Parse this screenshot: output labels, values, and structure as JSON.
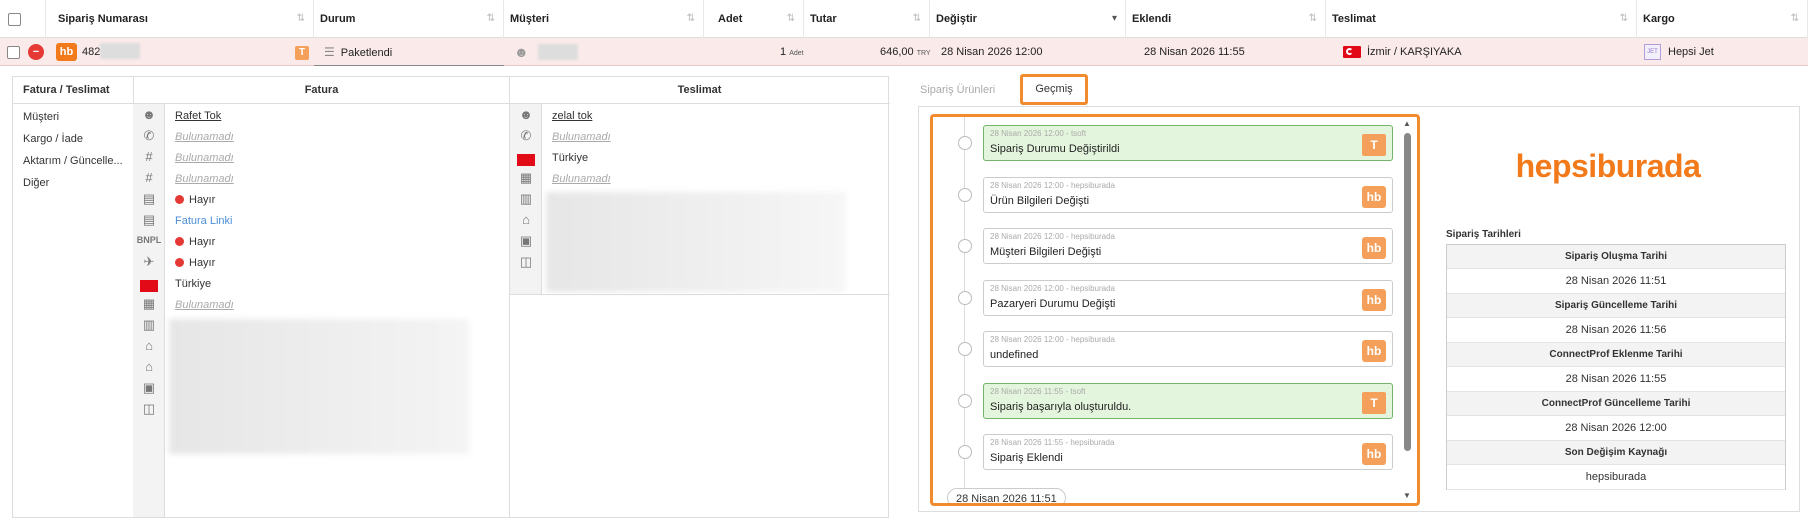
{
  "header": {
    "columns": [
      "Sipariş Numarası",
      "Durum",
      "Müşteri",
      "Adet",
      "Tutar",
      "Değiştir",
      "Eklendi",
      "Teslimat",
      "Kargo"
    ]
  },
  "row": {
    "hb_logo": "hb",
    "order_no_prefix": "482",
    "status_badge": "T",
    "status": "Paketlendi",
    "qty": "1",
    "qty_unit": "Adet",
    "amount": "646,00",
    "currency": "TRY",
    "changed": "28 Nisan 2026 12:00",
    "added": "28 Nisan 2026 11:55",
    "delivery": "İzmir / KARŞIYAKA",
    "cargo_icon": "JET",
    "cargo": "Hepsi Jet"
  },
  "address": {
    "title": "Fatura / Teslimat",
    "fatura_title": "Fatura",
    "teslimat_title": "Teslimat",
    "nav": [
      "Müşteri",
      "Kargo / İade",
      "Aktarım / Güncelle...",
      "Diğer"
    ],
    "fatura": {
      "name": "Rafet Tok",
      "not_found_1": "Bulunamadı",
      "not_found_2": "Bulunamadı",
      "not_found_3": "Bulunamadı",
      "flag1": "Hayır",
      "invoice_link": "Fatura Linki",
      "bnpl_label": "BNPL",
      "flag2": "Hayır",
      "flag3": "Hayır",
      "country": "Türkiye",
      "not_found_4": "Bulunamadı"
    },
    "teslimat": {
      "name": "zelal tok",
      "not_found_1": "Bulunamadı",
      "country": "Türkiye",
      "not_found_2": "Bulunamadı"
    }
  },
  "tabs": [
    "Sipariş Ürünleri",
    "Geçmiş"
  ],
  "history": [
    {
      "meta": "28 Nisan 2026 12:00 - tsoft",
      "text": "Sipariş Durumu Değiştirildi",
      "badge": "T",
      "green": true
    },
    {
      "meta": "28 Nisan 2026 12:00 - hepsiburada",
      "text": "Ürün Bilgileri Değişti",
      "badge": "hb",
      "green": false
    },
    {
      "meta": "28 Nisan 2026 12:00 - hepsiburada",
      "text": "Müşteri Bilgileri Değişti",
      "badge": "hb",
      "green": false
    },
    {
      "meta": "28 Nisan 2026 12:00 - hepsiburada",
      "text": "Pazaryeri Durumu Değişti",
      "badge": "hb",
      "green": false
    },
    {
      "meta": "28 Nisan 2026 12:00 - hepsiburada",
      "text": "undefined",
      "badge": "hb",
      "green": false
    },
    {
      "meta": "28 Nisan 2026 11:55 - tsoft",
      "text": "Sipariş başarıyla oluşturuldu.",
      "badge": "T",
      "green": true
    },
    {
      "meta": "28 Nisan 2026 11:55 - hepsiburada",
      "text": "Sipariş Eklendi",
      "badge": "hb",
      "green": false
    }
  ],
  "history_footer": "28 Nisan 2026 11:51",
  "brand": "hepsiburada",
  "dates": {
    "title": "Sipariş Tarihleri",
    "rows": [
      {
        "label": "Sipariş Oluşma Tarihi",
        "value": "28 Nisan 2026 11:51"
      },
      {
        "label": "Sipariş Güncelleme Tarihi",
        "value": "28 Nisan 2026 11:56"
      },
      {
        "label": "ConnectProf Eklenme Tarihi",
        "value": "28 Nisan 2026 11:55"
      },
      {
        "label": "ConnectProf Güncelleme Tarihi",
        "value": "28 Nisan 2026 12:00"
      },
      {
        "label": "Son Değişim Kaynağı",
        "value": "hepsiburada"
      }
    ]
  },
  "colors": {
    "accent": "#f27a1a",
    "highlight": "#f28a2e",
    "row_bg": "#fbeaea",
    "green": "#e4f5dd"
  }
}
